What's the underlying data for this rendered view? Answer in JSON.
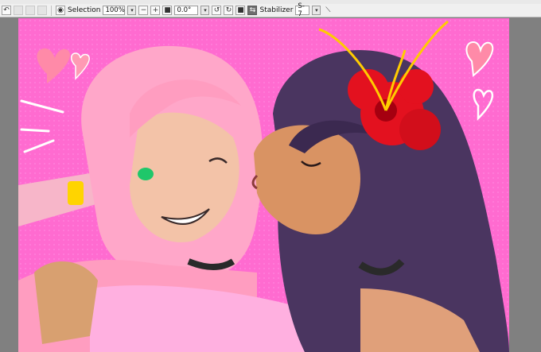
{
  "toolbar": {
    "selection_label": "Selection",
    "zoom_value": "100%",
    "rotation_value": "0.0°",
    "stabilizer_label": "Stabilizer",
    "stabilizer_value": "S-7"
  },
  "icons": {
    "undo": "undo-icon",
    "redo": "redo-icon",
    "view": "eye-icon",
    "zoom_out": "minus-icon",
    "zoom_in": "plus-icon",
    "fit": "fit-icon",
    "rotate_left": "rotate-left-icon",
    "rotate_right": "rotate-right-icon",
    "reset": "reset-icon",
    "flip": "flip-icon",
    "pen": "pen-icon"
  },
  "colors": {
    "canvas_bg": "#ff6bd0",
    "pink_hair": "#ffa7c9",
    "dark_hair": "#4a3560",
    "flower": "#e3111f",
    "skin_light": "#f3c3a8",
    "skin_dark": "#d99363"
  }
}
